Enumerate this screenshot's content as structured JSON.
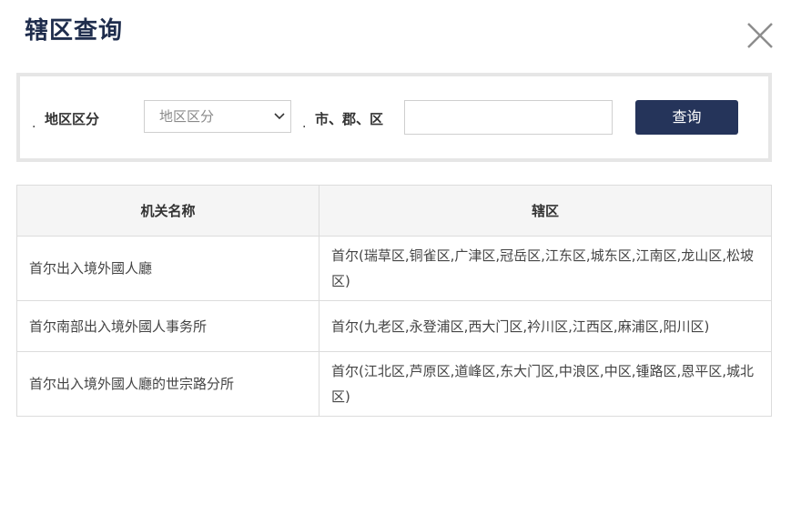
{
  "dialog": {
    "title": "辖区查询"
  },
  "search": {
    "bullet": ".",
    "region_label": "地区区分",
    "region_select_value": "地区区分",
    "city_label": "市、郡、区",
    "city_input_value": "",
    "query_button": "查询"
  },
  "table": {
    "headers": [
      "机关名称",
      "辖区"
    ],
    "rows": [
      {
        "name": "首尔出入境外國人廳",
        "jurisdiction": "首尔(瑞草区,铜雀区,广津区,冠岳区,江东区,城东区,江南区,龙山区,松坡区)"
      },
      {
        "name": "首尔南部出入境外國人事务所",
        "jurisdiction": "首尔(九老区,永登浦区,西大门区,衿川区,江西区,麻浦区,阳川区)"
      },
      {
        "name": "首尔出入境外國人廳的世宗路分所",
        "jurisdiction": "首尔(江北区,芦原区,道峰区,东大门区,中浪区,中区,锺路区,恩平区,城北区)"
      }
    ]
  },
  "icons": {
    "close": "close-icon",
    "select_caret": "chevron-down-icon"
  },
  "colors": {
    "title": "#1f2d4d",
    "button": "#25345a"
  }
}
